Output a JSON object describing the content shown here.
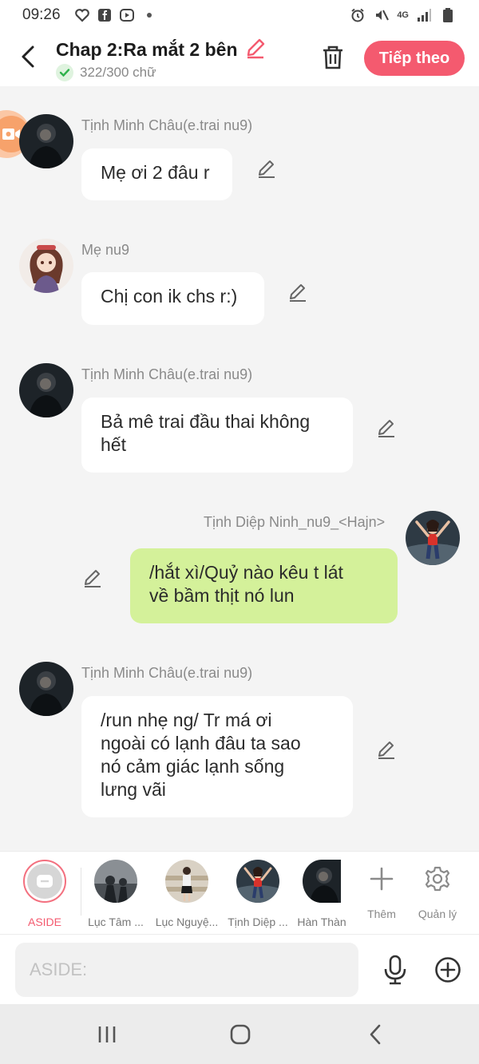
{
  "status_bar": {
    "time": "09:26",
    "network": "4G"
  },
  "header": {
    "title": "Chap 2:Ra mắt 2 bên",
    "word_count": "322/300 chữ",
    "next_label": "Tiếp theo"
  },
  "messages": [
    {
      "sender": "Tịnh Minh Châu(e.trai nu9)",
      "lines": [
        "Mẹ ơi 2 đâu r"
      ]
    },
    {
      "sender": "Mẹ nu9",
      "lines": [
        "Chị con ik chs r:)"
      ]
    },
    {
      "sender": "Tịnh Minh Châu(e.trai nu9)",
      "lines": [
        "Bả mê trai đầu thai không",
        "hết"
      ]
    },
    {
      "sender": "Tịnh Diệp Ninh_nu9_<Hajn>",
      "lines": [
        "/hắt xì/Quỷ nào kêu t lát",
        "về bầm thịt nó lun"
      ]
    },
    {
      "sender": "Tịnh Minh Châu(e.trai nu9)",
      "lines": [
        "/run nhẹ ng/ Tr má ơi",
        "ngoài có lạnh đâu ta sao",
        "nó cảm giác lạnh sống",
        "lưng vãi"
      ]
    }
  ],
  "characters": [
    {
      "label": "ASIDE"
    },
    {
      "label": "Lục Tâm ..."
    },
    {
      "label": "Lục Nguyệ..."
    },
    {
      "label": "Tịnh Diệp ..."
    },
    {
      "label": "Hàn Thàn"
    }
  ],
  "tools": {
    "add_label": "Thêm",
    "manage_label": "Quản lý"
  },
  "input": {
    "placeholder": "ASIDE:"
  },
  "colors": {
    "accent": "#f45a6f",
    "my_bubble": "#d4f19a",
    "other_bubble": "#ffffff",
    "background": "#f4f4f4"
  }
}
